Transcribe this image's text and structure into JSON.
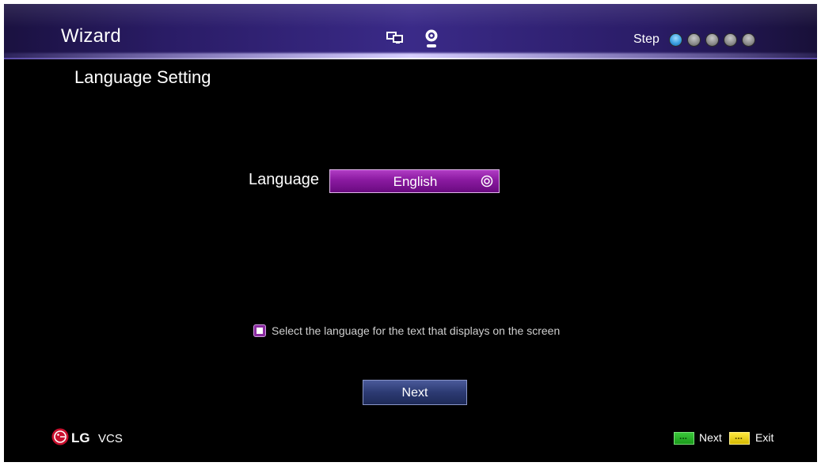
{
  "header": {
    "title": "Wizard",
    "step_label": "Step",
    "steps_total": 5,
    "current_step": 1,
    "icons": [
      "monitor-icon",
      "webcam-icon"
    ]
  },
  "page": {
    "title": "Language Setting"
  },
  "language": {
    "label": "Language",
    "value": "English"
  },
  "info": {
    "text": "Select the language for the text that displays on the screen"
  },
  "buttons": {
    "next_label": "Next"
  },
  "footer": {
    "brand_lg": "LG",
    "brand_vcs": "VCS",
    "hint_next": "Next",
    "hint_exit": "Exit"
  },
  "colors": {
    "background": "#000000",
    "header": "#2a1c66",
    "select_accent": "#8a1aa0",
    "button": "#2c3a72",
    "active_step": "#3aa0e0",
    "lg_logo": "#c8102e",
    "green_key": "#1a9a1a",
    "yellow_key": "#d4b800"
  }
}
